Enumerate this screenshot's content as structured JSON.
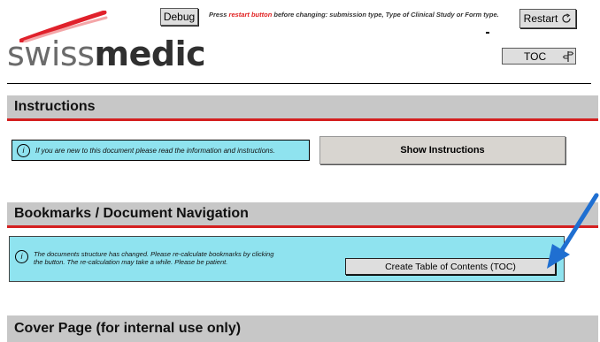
{
  "header": {
    "logo": {
      "light_text": "swiss",
      "bold_text": "medic"
    },
    "debug_label": "Debug",
    "notice": {
      "prefix": "Press ",
      "highlight": "restart button",
      "suffix": " before changing: submission type, Type of Clinical Study or Form type."
    },
    "restart_label": "Restart",
    "toc_label": "TOC"
  },
  "sections": {
    "instructions": {
      "title": "Instructions",
      "info_text": "If you are new to this document please read the information and instructions.",
      "button_label": "Show Instructions"
    },
    "bookmarks": {
      "title": "Bookmarks / Document Navigation",
      "info_text_line1": "The documents structure has changed. Please re-calculate bookmarks by clicking",
      "info_text_line2": "the button. The re-calculation may take a while. Please be patient.",
      "button_label": "Create Table of Contents (TOC)"
    },
    "cover": {
      "title": "Cover Page (for internal use only)"
    }
  },
  "colors": {
    "section_bar": "#c7c7c7",
    "red_rule": "#d42020",
    "info_bg": "#8fe3ef",
    "arrow": "#1f6fd1",
    "logo_accent": "#e0212b"
  },
  "icons": {
    "restart": "refresh-icon",
    "toc": "signpost-icon",
    "info": "info-icon",
    "annotation": "arrow-icon"
  }
}
